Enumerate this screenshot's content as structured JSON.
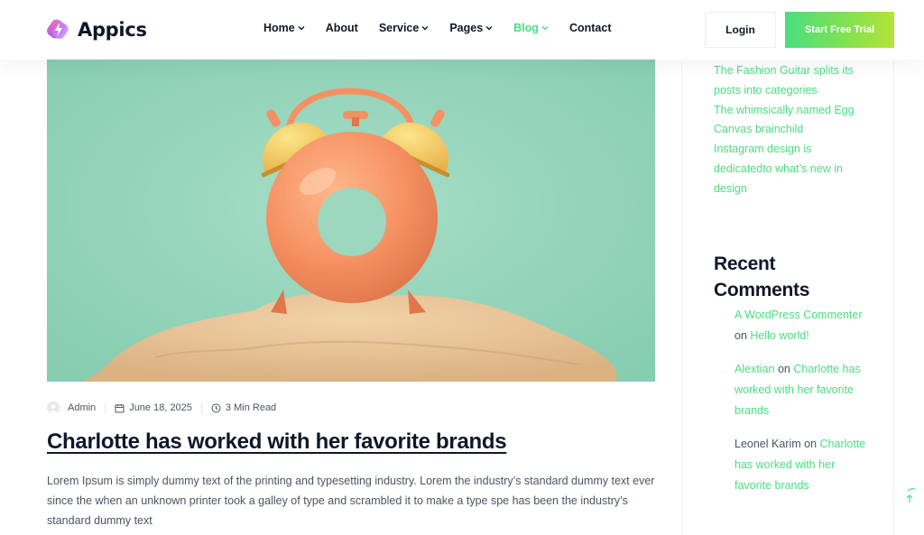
{
  "brand": {
    "name": "Appics",
    "accent": "#4ade80",
    "dark": "#0f172a"
  },
  "nav": {
    "items": [
      {
        "label": "Home",
        "dropdown": true,
        "active": false
      },
      {
        "label": "About",
        "dropdown": false,
        "active": false
      },
      {
        "label": "Service",
        "dropdown": true,
        "active": false
      },
      {
        "label": "Pages",
        "dropdown": true,
        "active": false
      },
      {
        "label": "Blog",
        "dropdown": true,
        "active": true
      },
      {
        "label": "Contact",
        "dropdown": false,
        "active": false
      }
    ],
    "login_label": "Login",
    "trial_label": "Start Free Trial"
  },
  "post": {
    "author": "Admin",
    "date": "June 18, 2025",
    "read_time": "3 Min Read",
    "title": "Charlotte has worked with her favorite brands",
    "excerpt": "Lorem Ipsum is simply dummy text of the printing and typesetting industry. Lorem the industry’s standard dummy text ever since the when an unknown printer took a galley of type and scrambled it to make a type spe has been the industry’s standard dummy text"
  },
  "sidebar": {
    "recent_posts": [
      "The Fashion Guitar splits its posts into categories",
      "The whimsically named Egg Canvas brainchild",
      "Instagram design is dedicatedto what’s new in design"
    ],
    "comments_title": "Recent Comments",
    "comments": [
      {
        "author": "A WordPress Commenter",
        "on": "on",
        "post": "Hello world!"
      },
      {
        "author": "Alextian",
        "on": "on",
        "post": "Charlotte has worked with her favorite brands"
      },
      {
        "author": "Leonel Karim",
        "on": "on",
        "post": "Charlotte has worked with her favorite brands"
      }
    ]
  }
}
